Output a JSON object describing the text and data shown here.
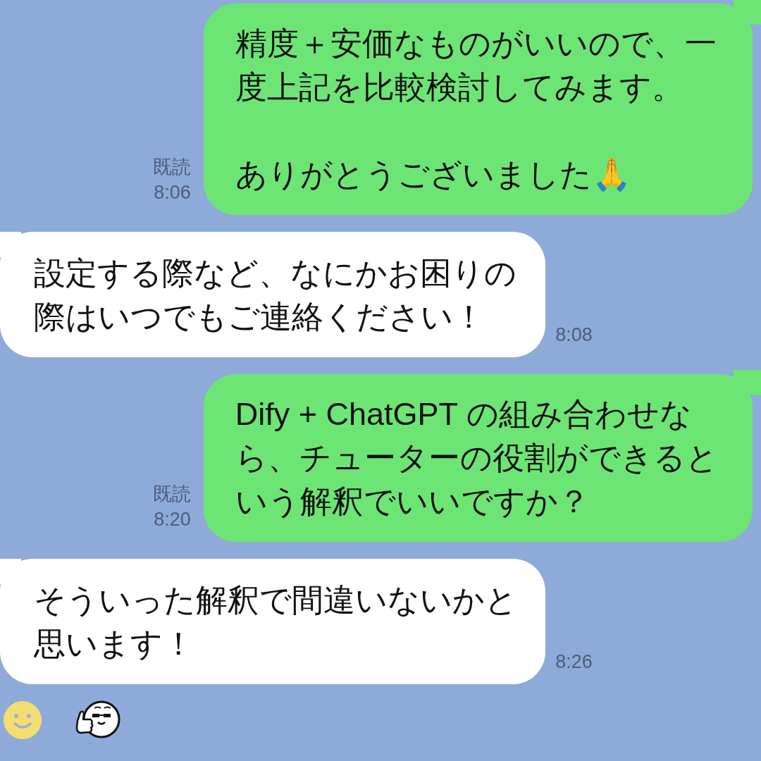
{
  "messages": [
    {
      "kind": "sent",
      "paragraphs": [
        "精度＋安価なものがいいので、一度上記を比較検討してみます。",
        "ありがとうございました🙏"
      ],
      "read_label": "既読",
      "time": "8:06"
    },
    {
      "kind": "received",
      "paragraphs": [
        "設定する際など、なにかお困りの際はいつでもご連絡ください！"
      ],
      "time": "8:08"
    },
    {
      "kind": "sent",
      "paragraphs": [
        "Dify + ChatGPT の組み合わせなら、チューターの役割ができるという解釈でいいですか？"
      ],
      "read_label": "既読",
      "time": "8:20"
    },
    {
      "kind": "received",
      "paragraphs": [
        "そういった解釈で間違いないかと思います！"
      ],
      "time": "8:26"
    }
  ]
}
